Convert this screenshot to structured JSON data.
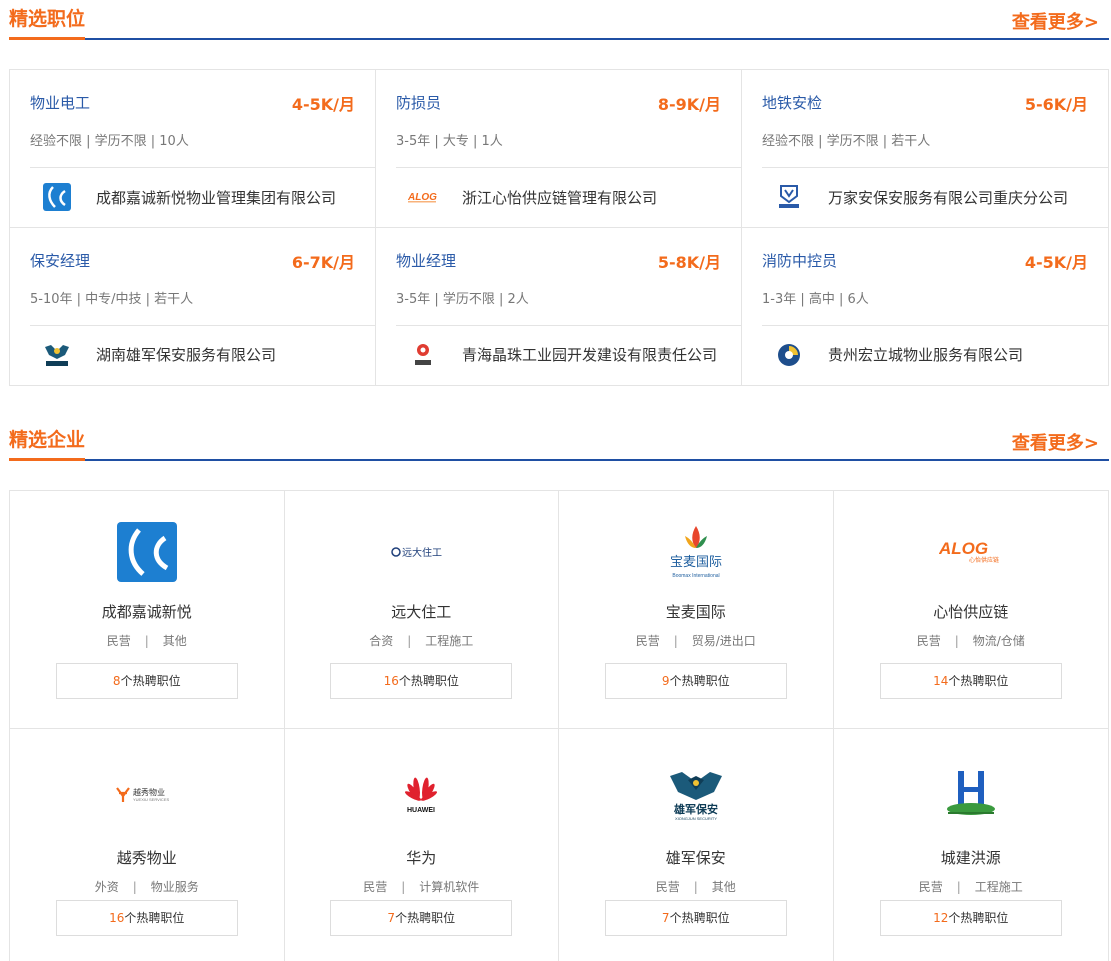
{
  "jobs_section": {
    "title": "精选职位",
    "more": "查看更多>"
  },
  "jobs": [
    {
      "title": "物业电工",
      "salary": "4-5K/月",
      "requirements": "经验不限 | 学历不限 | 10人",
      "company": "成都嘉诚新悦物业管理集团有限公司",
      "logo": "jiacheng-logo"
    },
    {
      "title": "防损员",
      "salary": "8-9K/月",
      "requirements": "3-5年 | 大专 | 1人",
      "company": "浙江心怡供应链管理有限公司",
      "logo": "alog-logo"
    },
    {
      "title": "地铁安检",
      "salary": "5-6K/月",
      "requirements": "经验不限 | 学历不限 | 若干人",
      "company": "万家安保安服务有限公司重庆分公司",
      "logo": "wanjiaan-logo"
    },
    {
      "title": "保安经理",
      "salary": "6-7K/月",
      "requirements": "5-10年 | 中专/中技 | 若干人",
      "company": "湖南雄军保安服务有限公司",
      "logo": "xiongjun-logo"
    },
    {
      "title": "物业经理",
      "salary": "5-8K/月",
      "requirements": "3-5年 | 学历不限 | 2人",
      "company": "青海晶珠工业园开发建设有限责任公司",
      "logo": "jingzhu-logo"
    },
    {
      "title": "消防中控员",
      "salary": "4-5K/月",
      "requirements": "1-3年 | 高中 | 6人",
      "company": "贵州宏立城物业服务有限公司",
      "logo": "honglicheng-logo"
    }
  ],
  "companies_section": {
    "title": "精选企业",
    "more": "查看更多>"
  },
  "companies": [
    {
      "name": "成都嘉诚新悦",
      "type": "民营",
      "industry": "其他",
      "count": "8",
      "suffix": "个热聘职位",
      "logo": "jiacheng-logo"
    },
    {
      "name": "远大住工",
      "type": "合资",
      "industry": "工程施工",
      "count": "16",
      "suffix": "个热聘职位",
      "logo": "yuanda-logo",
      "logo_text": "远大住工"
    },
    {
      "name": "宝麦国际",
      "type": "民营",
      "industry": "贸易/进出口",
      "count": "9",
      "suffix": "个热聘职位",
      "logo": "baomai-logo",
      "logo_text": "宝麦国际",
      "logo_sub": "Boomax International"
    },
    {
      "name": "心怡供应链",
      "type": "民营",
      "industry": "物流/仓储",
      "count": "14",
      "suffix": "个热聘职位",
      "logo": "alog-logo",
      "logo_text": "ALOG",
      "logo_sub": "心怡供应链"
    },
    {
      "name": "越秀物业",
      "type": "外资",
      "industry": "物业服务",
      "count": "16",
      "suffix": "个热聘职位",
      "logo": "yuexiu-logo",
      "logo_text": "越秀物业",
      "logo_sub": "YUEXIU SERVICES"
    },
    {
      "name": "华为",
      "type": "民营",
      "industry": "计算机软件",
      "count": "7",
      "suffix": "个热聘职位",
      "logo": "huawei-logo",
      "logo_text": "HUAWEI"
    },
    {
      "name": "雄军保安",
      "type": "民营",
      "industry": "其他",
      "count": "7",
      "suffix": "个热聘职位",
      "logo": "xiongjun-logo",
      "logo_text": "雄军保安",
      "logo_sub": "XIONGJUN SECURITY"
    },
    {
      "name": "城建洪源",
      "type": "民营",
      "industry": "工程施工",
      "count": "12",
      "suffix": "个热聘职位",
      "logo": "hongyuan-logo"
    }
  ]
}
